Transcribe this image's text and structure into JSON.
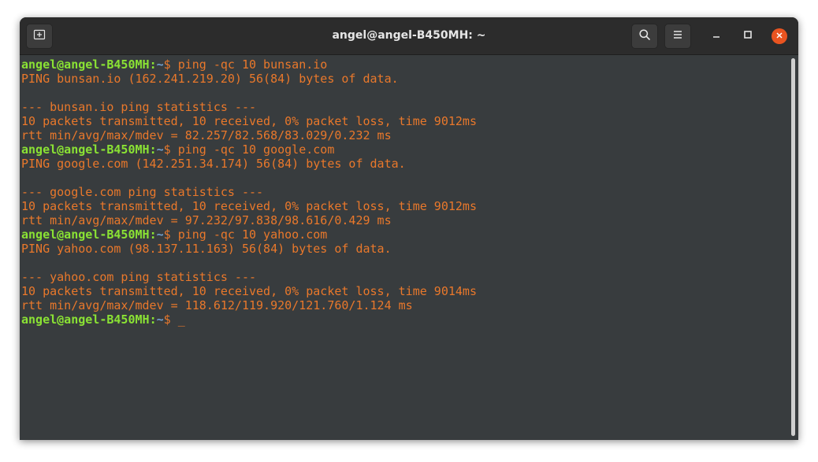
{
  "window": {
    "title": "angel@angel-B450MH: ~"
  },
  "icons": {
    "new_tab": "new-tab-icon",
    "search": "search-icon",
    "menu": "hamburger-menu-icon",
    "minimize": "minimize-icon",
    "maximize": "maximize-icon",
    "close": "close-icon"
  },
  "colors": {
    "prompt_user": "#8ae234",
    "prompt_path": "#729fcf",
    "output": "#e9782b",
    "background": "#383c3e",
    "close_button": "#e95420"
  },
  "terminal": {
    "lines": [
      {
        "prompt": true,
        "user": "angel@angel-B450MH",
        "sep": ":",
        "path": "~",
        "sym": "$ ",
        "cmd": "ping -qc 10 bunsan.io"
      },
      {
        "text": "PING bunsan.io (162.241.219.20) 56(84) bytes of data."
      },
      {
        "text": ""
      },
      {
        "text": "--- bunsan.io ping statistics ---"
      },
      {
        "text": "10 packets transmitted, 10 received, 0% packet loss, time 9012ms"
      },
      {
        "text": "rtt min/avg/max/mdev = 82.257/82.568/83.029/0.232 ms"
      },
      {
        "prompt": true,
        "user": "angel@angel-B450MH",
        "sep": ":",
        "path": "~",
        "sym": "$ ",
        "cmd": "ping -qc 10 google.com"
      },
      {
        "text": "PING google.com (142.251.34.174) 56(84) bytes of data."
      },
      {
        "text": ""
      },
      {
        "text": "--- google.com ping statistics ---"
      },
      {
        "text": "10 packets transmitted, 10 received, 0% packet loss, time 9012ms"
      },
      {
        "text": "rtt min/avg/max/mdev = 97.232/97.838/98.616/0.429 ms"
      },
      {
        "prompt": true,
        "user": "angel@angel-B450MH",
        "sep": ":",
        "path": "~",
        "sym": "$ ",
        "cmd": "ping -qc 10 yahoo.com"
      },
      {
        "text": "PING yahoo.com (98.137.11.163) 56(84) bytes of data."
      },
      {
        "text": ""
      },
      {
        "text": "--- yahoo.com ping statistics ---"
      },
      {
        "text": "10 packets transmitted, 10 received, 0% packet loss, time 9014ms"
      },
      {
        "text": "rtt min/avg/max/mdev = 118.612/119.920/121.760/1.124 ms"
      },
      {
        "prompt": true,
        "user": "angel@angel-B450MH",
        "sep": ":",
        "path": "~",
        "sym": "$ ",
        "cmd": "",
        "cursor": "_"
      }
    ]
  }
}
